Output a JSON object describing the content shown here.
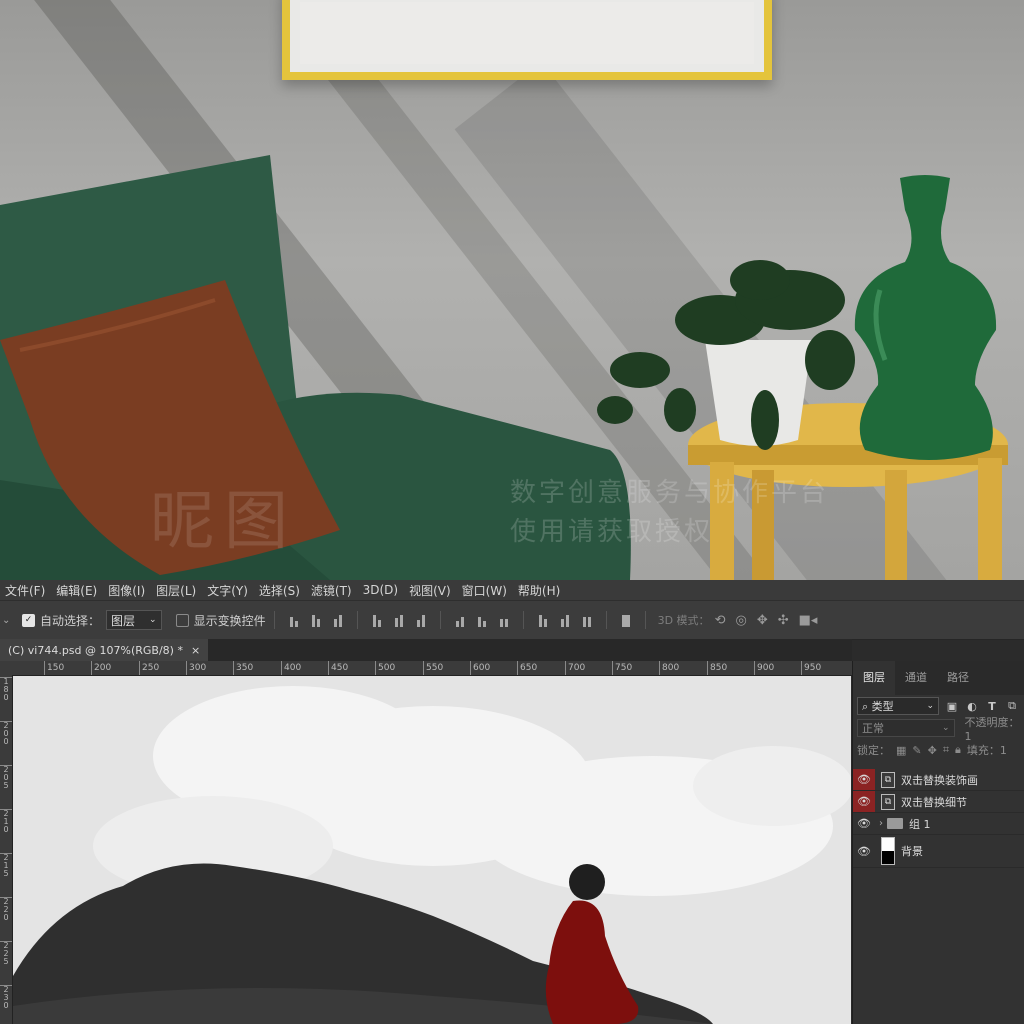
{
  "menu": [
    "文件(F)",
    "编辑(E)",
    "图像(I)",
    "图层(L)",
    "文字(Y)",
    "选择(S)",
    "滤镜(T)",
    "3D(D)",
    "视图(V)",
    "窗口(W)",
    "帮助(H)"
  ],
  "options": {
    "auto_select_label": "自动选择：",
    "auto_select_checked": true,
    "auto_select_value": "图层",
    "show_transform_label": "显示变换控件",
    "show_transform_checked": false,
    "mode_3d_label": "3D 模式："
  },
  "document": {
    "tab_title": "(C) vi744.psd @ 107%(RGB/8) *",
    "close_glyph": "×"
  },
  "ruler": {
    "top_ticks": [
      "150",
      "200",
      "250",
      "300",
      "350",
      "400",
      "450",
      "500",
      "550",
      "600",
      "650",
      "700",
      "750",
      "800",
      "850",
      "900",
      "950"
    ],
    "left_ticks": [
      "1\n8\n0",
      "2\n0\n0",
      "2\n0\n5",
      "2\n1\n0",
      "2\n1\n5",
      "2\n2\n0",
      "2\n2\n5",
      "2\n3\n0"
    ]
  },
  "watermark": {
    "logo": "昵图",
    "line1": "数字创意服务与协作平台",
    "line2": "使用请获取授权"
  },
  "layers_panel": {
    "tabs": [
      "图层",
      "通道",
      "路径"
    ],
    "active_tab": "图层",
    "filter_label": "类型",
    "blend_mode": "正常",
    "opacity_label": "不透明度：",
    "opacity_value": "1",
    "lock_label": "锁定：",
    "fill_label": "填充：",
    "fill_value": "1",
    "layers": [
      {
        "name": "双击替换装饰画",
        "type": "smart",
        "eye_highlight": true
      },
      {
        "name": "双击替换细节",
        "type": "smart",
        "eye_highlight": true
      },
      {
        "name": "组 1",
        "type": "group",
        "eye_highlight": false
      },
      {
        "name": "背景",
        "type": "background",
        "eye_highlight": false
      }
    ]
  },
  "colors": {
    "sofa": "#2f5a45",
    "pillow": "#7a3d22",
    "table": "#e1b74a",
    "vase": "#1f6a3a",
    "frame": "#e4c43c",
    "figure_cloak": "#7d0f0d",
    "eye_highlight": "#8b2323"
  }
}
